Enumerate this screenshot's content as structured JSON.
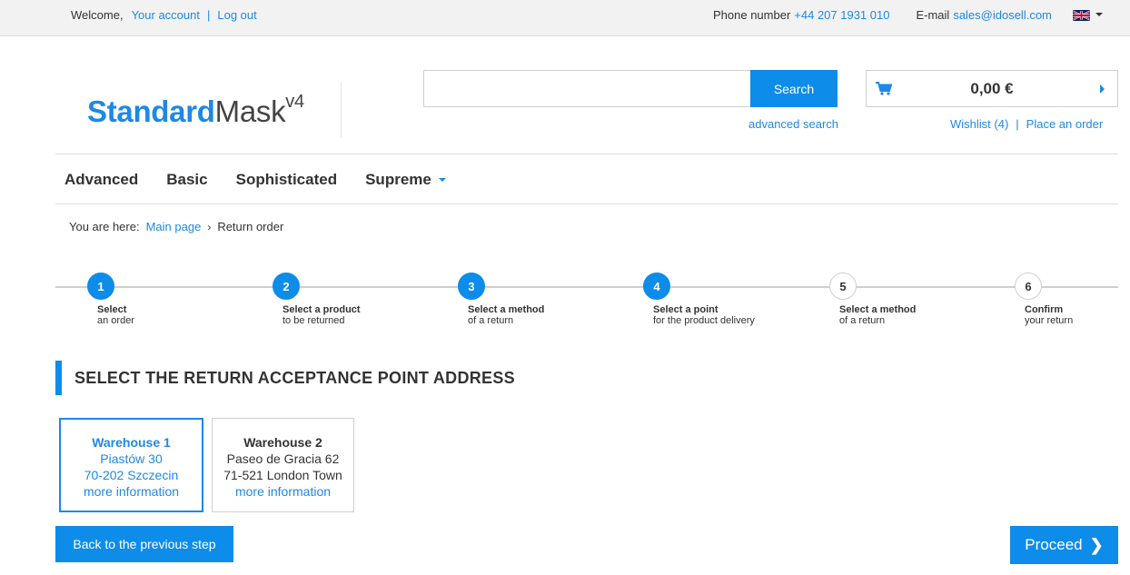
{
  "topbar": {
    "welcome": "Welcome,",
    "your_account": "Your account",
    "logout": "Log out",
    "separator": "|",
    "phone_label": "Phone number",
    "phone": "+44 207 1931 010",
    "email_label": "E-mail",
    "email": "sales@idosell.com",
    "language_icon": "uk-flag-icon"
  },
  "logo": {
    "part1": "Standard",
    "part2": "Mask",
    "sup": "v4"
  },
  "search": {
    "placeholder": "",
    "value": "",
    "button": "Search",
    "advanced": "advanced search"
  },
  "cart": {
    "amount": "0,00 €",
    "wishlist": "Wishlist (4)",
    "place_order": "Place an order",
    "separator": "|"
  },
  "nav": {
    "items": [
      "Advanced",
      "Basic",
      "Sophisticated",
      "Supreme"
    ]
  },
  "breadcrumb": {
    "label": "You are here:",
    "home": "Main page",
    "chevron": "›",
    "current": "Return order"
  },
  "steps": [
    {
      "num": "1",
      "line1": "Select",
      "line2": "an order",
      "state": "active"
    },
    {
      "num": "2",
      "line1": "Select a product",
      "line2": "to be returned",
      "state": "active"
    },
    {
      "num": "3",
      "line1": "Select a method",
      "line2": "of a return",
      "state": "active"
    },
    {
      "num": "4",
      "line1": "Select a point",
      "line2": "for the product delivery",
      "state": "active"
    },
    {
      "num": "5",
      "line1": "Select a method",
      "line2": "of a return",
      "state": "inactive"
    },
    {
      "num": "6",
      "line1": "Confirm",
      "line2": "your return",
      "state": "inactive"
    }
  ],
  "section_title": "SELECT THE RETURN ACCEPTANCE POINT ADDRESS",
  "warehouses": [
    {
      "name": "Warehouse 1",
      "street": "Piastów 30",
      "city": "70-202 Szczecin",
      "more": "more information",
      "selected": true
    },
    {
      "name": "Warehouse 2",
      "street": "Paseo de Gracia 62",
      "city": "71-521 London Town",
      "more": "more information",
      "selected": false
    }
  ],
  "buttons": {
    "back": "Back to the previous step",
    "proceed": "Proceed"
  },
  "colors": {
    "accent": "#0d8ce9",
    "link": "#1e88e5"
  }
}
